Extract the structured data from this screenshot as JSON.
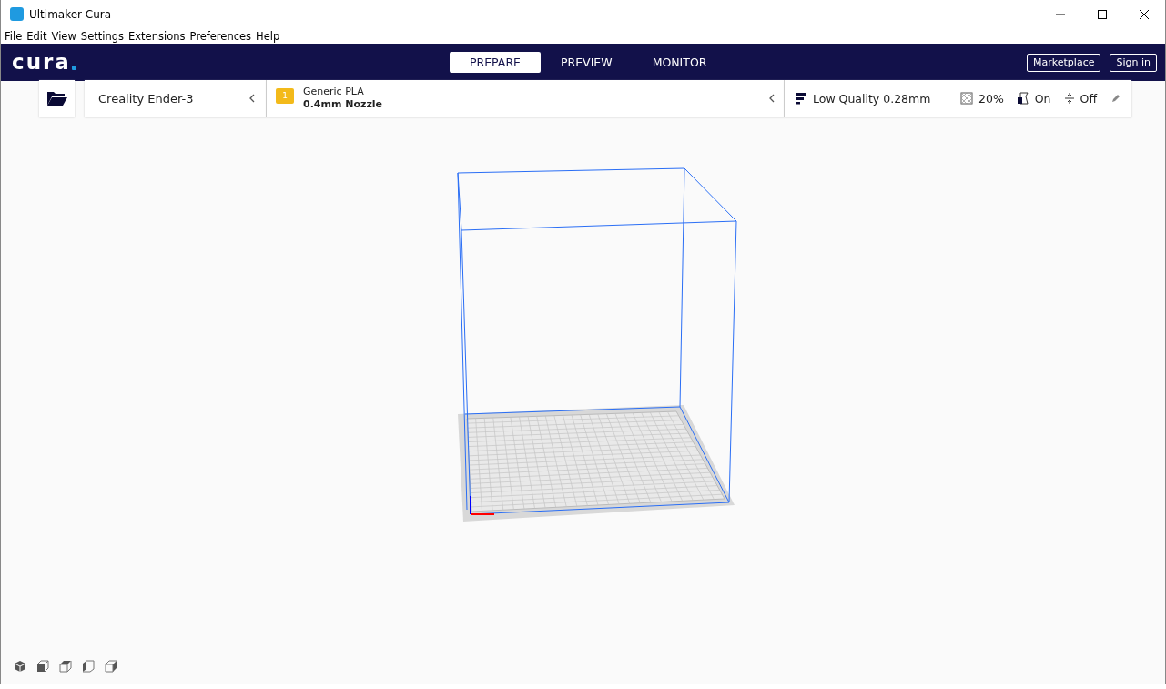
{
  "window": {
    "title": "Ultimaker Cura"
  },
  "menu": [
    "File",
    "Edit",
    "View",
    "Settings",
    "Extensions",
    "Preferences",
    "Help"
  ],
  "header": {
    "logo": "cura",
    "tabs": [
      {
        "label": "PREPARE",
        "selected": true
      },
      {
        "label": "PREVIEW",
        "selected": false
      },
      {
        "label": "MONITOR",
        "selected": false
      }
    ],
    "buttons": [
      "Marketplace",
      "Sign in"
    ]
  },
  "printer": {
    "name": "Creality Ender-3"
  },
  "material": {
    "extruder": "1",
    "name": "Generic PLA",
    "nozzle": "0.4mm Nozzle"
  },
  "print_settings": {
    "profile": "Low Quality 0.28mm",
    "infill": "20%",
    "support": "On",
    "adhesion": "Off"
  },
  "view_buttons": [
    {
      "kind": "perspective"
    },
    {
      "kind": "front"
    },
    {
      "kind": "top"
    },
    {
      "kind": "left"
    },
    {
      "kind": "right"
    }
  ]
}
